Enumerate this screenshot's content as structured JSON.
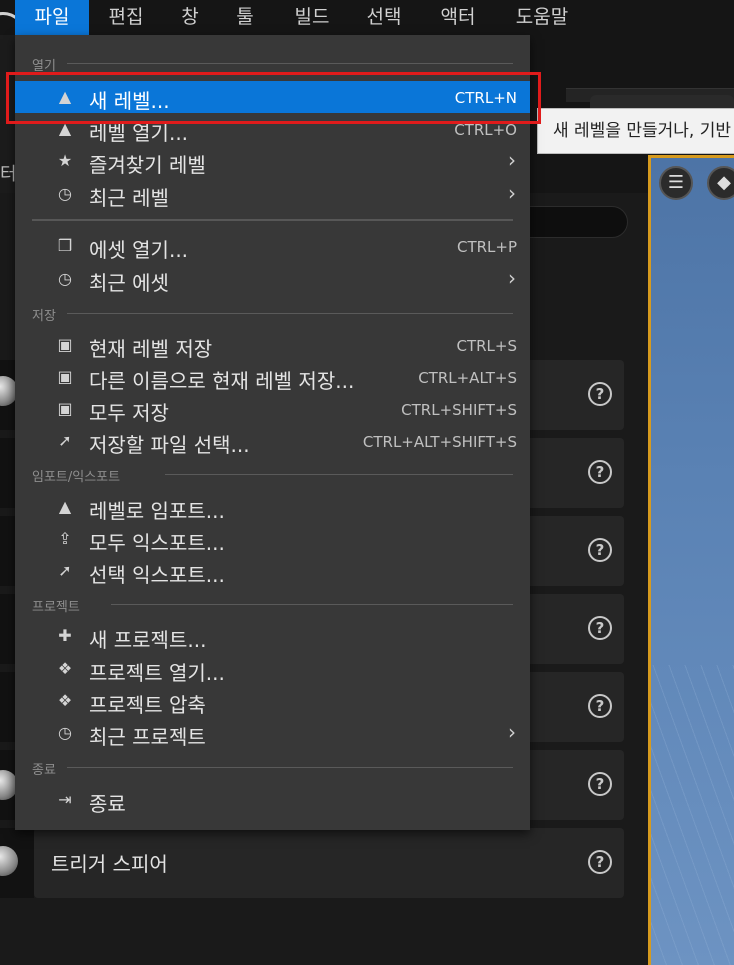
{
  "menubar": {
    "items": [
      "파일",
      "편집",
      "창",
      "툴",
      "빌드",
      "선택",
      "액터",
      "도움말"
    ]
  },
  "dropdown": {
    "sections": {
      "open": "열기",
      "save": "저장",
      "import_export": "임포트/익스포트",
      "project": "프로젝트",
      "exit": "종료"
    },
    "items": [
      {
        "label": "새 레벨...",
        "shortcut": "CTRL+N",
        "icon": "new-level-icon"
      },
      {
        "label": "레벨 열기...",
        "shortcut": "CTRL+O",
        "icon": "open-level-icon"
      },
      {
        "label": "즐겨찾기 레벨",
        "icon": "favorite-level-icon"
      },
      {
        "label": "최근 레벨",
        "icon": "recent-level-icon"
      },
      {
        "label": "에셋 열기...",
        "shortcut": "CTRL+P",
        "icon": "open-asset-icon"
      },
      {
        "label": "최근 에셋",
        "icon": "recent-asset-icon"
      },
      {
        "label": "현재 레벨 저장",
        "shortcut": "CTRL+S",
        "icon": "save-icon"
      },
      {
        "label": "다른 이름으로 현재 레벨 저장...",
        "shortcut": "CTRL+ALT+S",
        "icon": "save-as-icon"
      },
      {
        "label": "모두 저장",
        "shortcut": "CTRL+SHIFT+S",
        "icon": "save-all-icon"
      },
      {
        "label": "저장할 파일 선택...",
        "shortcut": "CTRL+ALT+SHIFT+S",
        "icon": "choose-files-icon"
      },
      {
        "label": "레벨로 임포트...",
        "icon": "import-icon"
      },
      {
        "label": "모두 익스포트...",
        "icon": "export-all-icon"
      },
      {
        "label": "선택 익스포트...",
        "icon": "export-selected-icon"
      },
      {
        "label": "새 프로젝트...",
        "icon": "new-project-icon"
      },
      {
        "label": "프로젝트 열기...",
        "icon": "open-project-icon"
      },
      {
        "label": "프로젝트 압축",
        "icon": "zip-project-icon"
      },
      {
        "label": "최근 프로젝트",
        "icon": "recent-project-icon"
      },
      {
        "label": "종료",
        "icon": "exit-icon"
      }
    ]
  },
  "tooltip": "새 레벨을 만들거나, 기반",
  "background": {
    "left_label": "터",
    "row_label": "트리거 스피어"
  },
  "colors": {
    "accent": "#0a76d8",
    "highlight_box": "#e01b1b",
    "viewport_border": "#d69a1e"
  }
}
